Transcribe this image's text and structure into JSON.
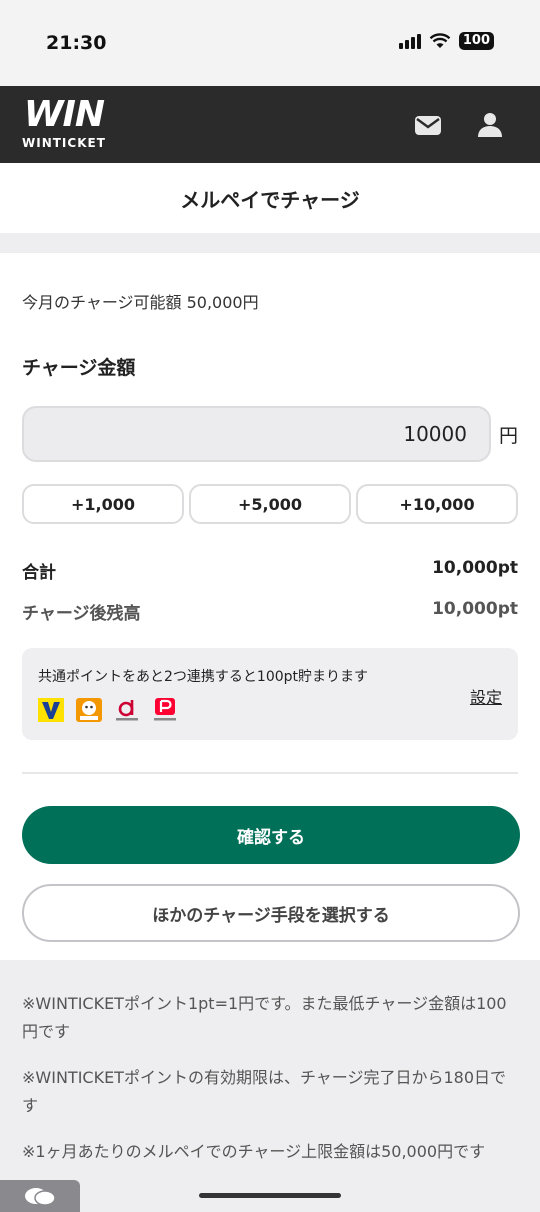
{
  "status_bar": {
    "time": "21:30",
    "battery": "100"
  },
  "header": {
    "logo_mark": "WIN",
    "logo_text": "WINTICKET"
  },
  "page": {
    "title": "メルペイでチャージ"
  },
  "charge": {
    "monthly_limit_text": "今月のチャージ可能額 50,000円",
    "section_heading": "チャージ金額",
    "amount_value": "10000",
    "yen_label": "円",
    "quick_buttons": [
      "+1,000",
      "+5,000",
      "+10,000"
    ]
  },
  "summary": {
    "total_label": "合計",
    "total_value": "10,000pt",
    "balance_label": "チャージ後残高",
    "balance_value": "10,000pt"
  },
  "points_card": {
    "message": "共通ポイントをあと2つ連携すると100pt貯まります",
    "logos": [
      "v-point-logo",
      "ponta-logo",
      "d-point-logo",
      "paypay-point-logo"
    ],
    "settings_label": "設定"
  },
  "actions": {
    "confirm_label": "確認する",
    "other_method_label": "ほかのチャージ手段を選択する"
  },
  "notes": [
    "※WINTICKETポイント1pt=1円です。また最低チャージ金額は100円です",
    "※WINTICKETポイントの有効期限は、チャージ完了日から180日です",
    "※1ヶ月あたりのメルペイでのチャージ上限金額は50,000円です"
  ],
  "colors": {
    "header_bg": "#2b2b2b",
    "primary": "#007059",
    "band": "#eeeef0"
  }
}
